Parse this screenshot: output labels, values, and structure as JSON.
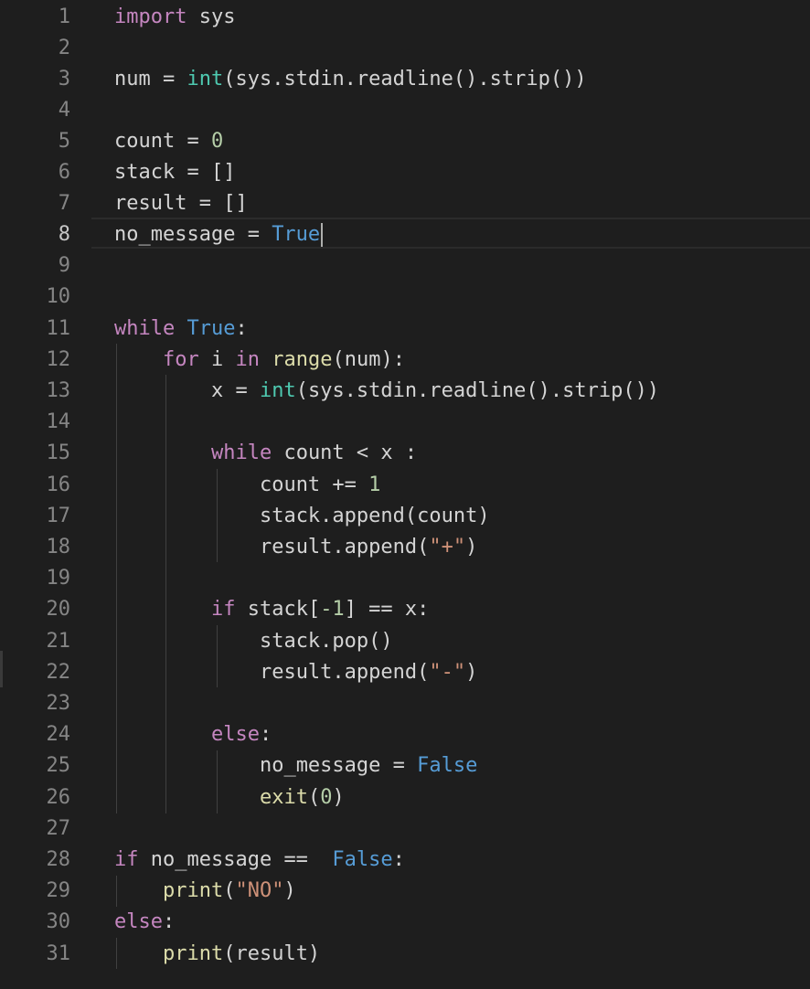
{
  "editor": {
    "active_line": 8,
    "theme_colors": {
      "background": "#1e1e1e",
      "keyword_control": "#c586c0",
      "keyword_constant": "#569cd6",
      "function": "#dcdcaa",
      "class": "#4ec9b0",
      "number": "#b5cea8",
      "string": "#ce9178",
      "line_number": "#858585"
    },
    "line_numbers": [
      "1",
      "2",
      "3",
      "4",
      "5",
      "6",
      "7",
      "8",
      "9",
      "10",
      "11",
      "12",
      "13",
      "14",
      "15",
      "16",
      "17",
      "18",
      "19",
      "20",
      "21",
      "22",
      "23",
      "24",
      "25",
      "26",
      "27",
      "28",
      "29",
      "30",
      "31"
    ],
    "tokens": {
      "l1_import": "import",
      "l1_sys": " sys",
      "l3_num": "num = ",
      "l3_int": "int",
      "l3_rest": "(sys.stdin.readline().strip())",
      "l5_count": "count = ",
      "l5_zero": "0",
      "l6_stack": "stack = []",
      "l7_result": "result = []",
      "l8_nomsg": "no_message = ",
      "l8_true": "True",
      "l11_while": "while",
      "l11_sp": " ",
      "l11_true": "True",
      "l11_colon": ":",
      "l12_indent": "    ",
      "l12_for": "for",
      "l12_i": " i ",
      "l12_in": "in",
      "l12_sp": " ",
      "l12_range": "range",
      "l12_rest": "(num):",
      "l13_indent": "        ",
      "l13_x": "x = ",
      "l13_int": "int",
      "l13_rest": "(sys.stdin.readline().strip())",
      "l15_indent": "        ",
      "l15_while": "while",
      "l15_rest": " count < x :",
      "l16_indent": "            ",
      "l16_count": "count += ",
      "l16_one": "1",
      "l17_indent": "            ",
      "l17_text": "stack.append(count)",
      "l18_indent": "            ",
      "l18_a": "result.append(",
      "l18_str": "\"+\"",
      "l18_b": ")",
      "l20_indent": "        ",
      "l20_if": "if",
      "l20_a": " stack[",
      "l20_neg": "-1",
      "l20_b": "] == x:",
      "l21_indent": "            ",
      "l21_text": "stack.pop()",
      "l22_indent": "            ",
      "l22_a": "result.append(",
      "l22_str": "\"-\"",
      "l22_b": ")",
      "l24_indent": "        ",
      "l24_else": "else",
      "l24_colon": ":",
      "l25_indent": "            ",
      "l25_nomsg": "no_message = ",
      "l25_false": "False",
      "l26_indent": "            ",
      "l26_exit": "exit",
      "l26_a": "(",
      "l26_zero": "0",
      "l26_b": ")",
      "l28_if": "if",
      "l28_rest": " no_message ==  ",
      "l28_false": "False",
      "l28_colon": ":",
      "l29_indent": "    ",
      "l29_print": "print",
      "l29_a": "(",
      "l29_str": "\"NO\"",
      "l29_b": ")",
      "l30_else": "else",
      "l30_colon": ":",
      "l31_indent": "    ",
      "l31_print": "print",
      "l31_rest": "(result)"
    }
  }
}
